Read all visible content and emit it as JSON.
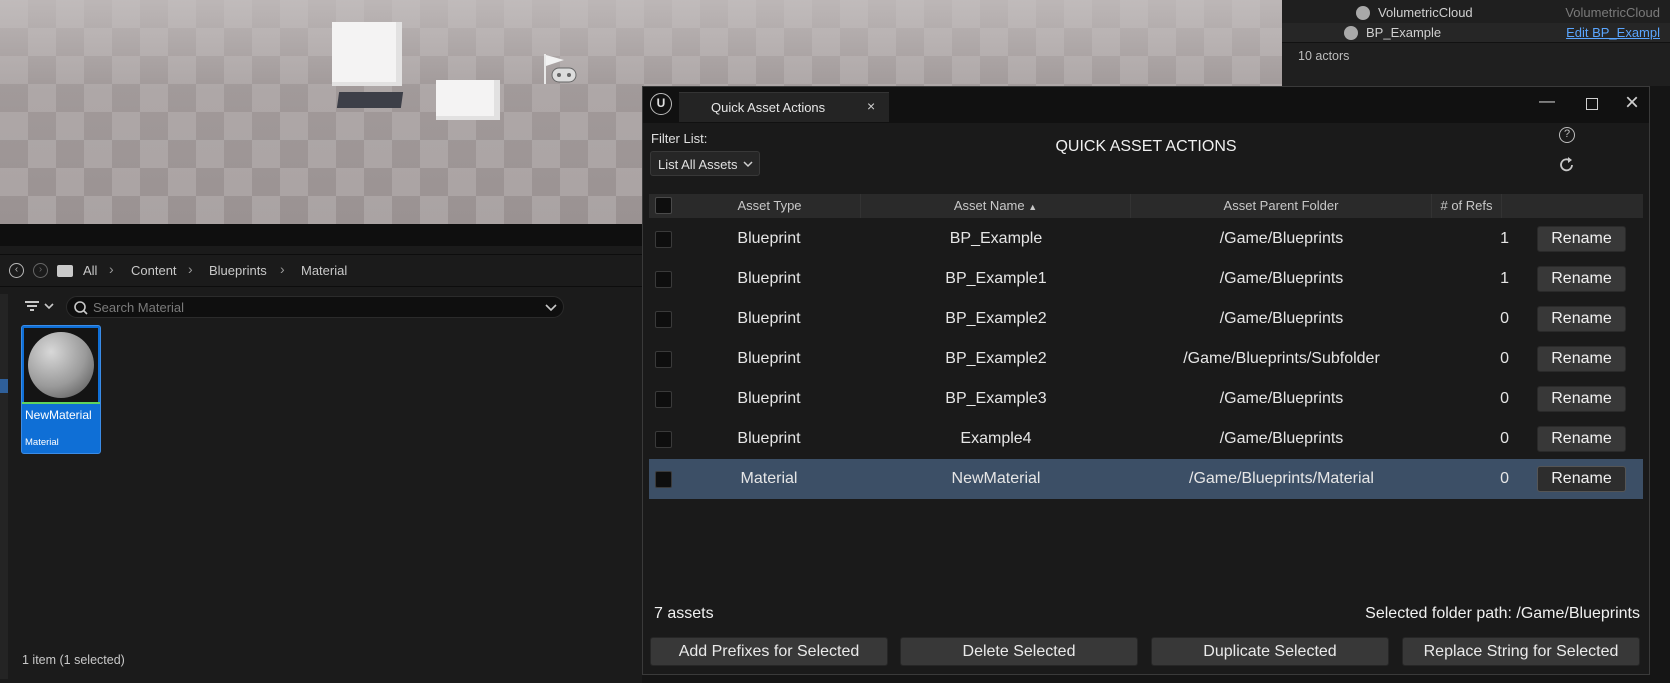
{
  "outliner": {
    "rows": [
      {
        "name": "VolumetricCloud",
        "type": "VolumetricCloud"
      },
      {
        "name": "BP_Example",
        "link": "Edit BP_Exampl"
      }
    ],
    "actor_count": "10 actors"
  },
  "browser": {
    "breadcrumb": [
      "All",
      "Content",
      "Blueprints",
      "Material"
    ],
    "search_placeholder": "Search Material",
    "asset_card": {
      "name": "NewMaterial",
      "type": "Material"
    },
    "status": "1 item (1 selected)"
  },
  "window": {
    "tab_title": "Quick Asset Actions",
    "filter_label": "Filter List:",
    "filter_value": "List All Assets",
    "heading": "QUICK ASSET ACTIONS",
    "columns": [
      "Asset Type",
      "Asset Name",
      "Asset Parent Folder",
      "# of Refs"
    ],
    "sorted_column_indicator": "ascending",
    "rows": [
      {
        "type": "Blueprint",
        "name": "BP_Example",
        "folder": "/Game/Blueprints",
        "refs": "1",
        "selected": false
      },
      {
        "type": "Blueprint",
        "name": "BP_Example1",
        "folder": "/Game/Blueprints",
        "refs": "1",
        "selected": false
      },
      {
        "type": "Blueprint",
        "name": "BP_Example2",
        "folder": "/Game/Blueprints",
        "refs": "0",
        "selected": false
      },
      {
        "type": "Blueprint",
        "name": "BP_Example2",
        "folder": "/Game/Blueprints/Subfolder",
        "refs": "0",
        "selected": false
      },
      {
        "type": "Blueprint",
        "name": "BP_Example3",
        "folder": "/Game/Blueprints",
        "refs": "0",
        "selected": false
      },
      {
        "type": "Blueprint",
        "name": "Example4",
        "folder": "/Game/Blueprints",
        "refs": "0",
        "selected": false
      },
      {
        "type": "Material",
        "name": "NewMaterial",
        "folder": "/Game/Blueprints/Material",
        "refs": "0",
        "selected": true
      }
    ],
    "rename_label": "Rename",
    "asset_count": "7 assets",
    "selected_folder": "Selected folder path: /Game/Blueprints",
    "buttons": [
      "Add Prefixes for Selected",
      "Delete Selected",
      "Duplicate Selected",
      "Replace String for Selected"
    ]
  },
  "colors": {
    "selection_row": "#3c4f66",
    "asset_card": "#0f6fd6",
    "link": "#5aa6ff"
  }
}
